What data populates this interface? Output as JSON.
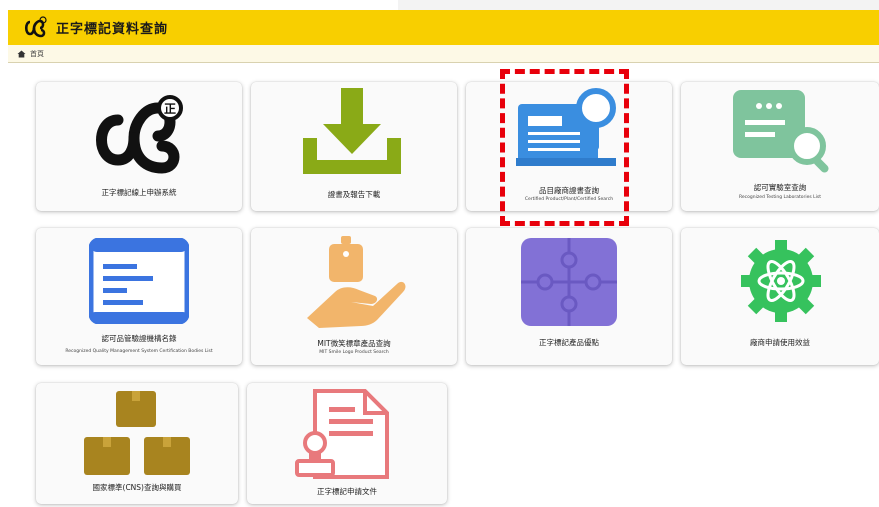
{
  "site": {
    "title": "正字標記資料查詢"
  },
  "breadcrumb": {
    "home_label": "首頁"
  },
  "tiles": [
    {
      "title": "正字標記線上申辦系統",
      "subtitle": "",
      "icon": "cns-logo-icon"
    },
    {
      "title": "證書及報告下載",
      "subtitle": "",
      "icon": "download-icon"
    },
    {
      "title": "品目廠商證書查詢",
      "subtitle": "Certified Product/Plant/Certified Search",
      "icon": "certificate-search-icon"
    },
    {
      "title": "認可實驗室查詢",
      "subtitle": "Recognized Testing Laboratories List",
      "icon": "laboratory-search-icon"
    },
    {
      "title": "認可品管驗證機構名錄",
      "subtitle": "Recognized Quality Management System Certification Bodies List",
      "icon": "list-window-icon"
    },
    {
      "title": "MIT微笑標章產品查詢",
      "subtitle": "MIT Smile Logo Product Search",
      "icon": "hand-tag-icon"
    },
    {
      "title": "正字標記產品優點",
      "subtitle": "",
      "icon": "puzzle-icon"
    },
    {
      "title": "廠商申請使用效益",
      "subtitle": "",
      "icon": "atom-gear-icon"
    },
    {
      "title": "國家標準(CNS)查詢與購買",
      "subtitle": "",
      "icon": "boxes-icon"
    },
    {
      "title": "正字標記申請文件",
      "subtitle": "",
      "icon": "document-stamp-icon"
    }
  ],
  "colors": {
    "header": "#f8cf00",
    "highlight": "#e8000b",
    "download_green": "#8aaa17",
    "blue": "#3a8ee0",
    "lab_green": "#7fc49d",
    "list_blue": "#3b74e0",
    "puzzle_purple": "#8271d6",
    "gear_green": "#36c25d",
    "box_brown": "#a8841f",
    "doc_red": "#e8797c",
    "hand_orange": "#f2b56b"
  }
}
